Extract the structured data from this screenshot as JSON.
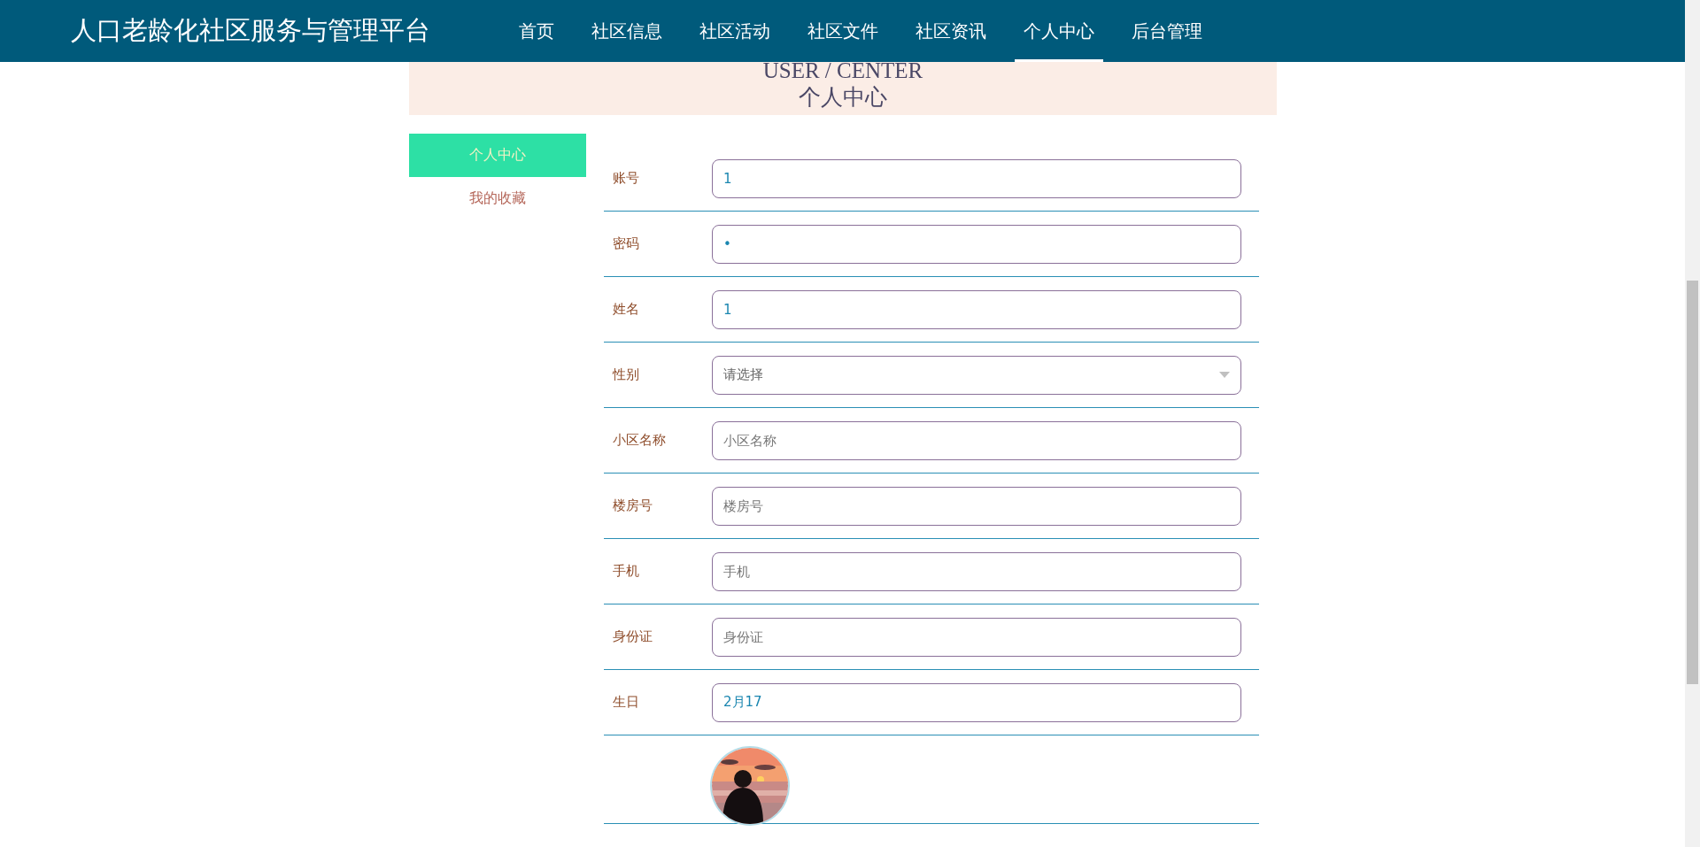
{
  "header": {
    "title": "人口老龄化社区服务与管理平台",
    "nav": [
      {
        "label": "首页",
        "selected": false
      },
      {
        "label": "社区信息",
        "selected": false
      },
      {
        "label": "社区活动",
        "selected": false
      },
      {
        "label": "社区文件",
        "selected": false
      },
      {
        "label": "社区资讯",
        "selected": false
      },
      {
        "label": "个人中心",
        "selected": true
      },
      {
        "label": "后台管理",
        "selected": false
      }
    ]
  },
  "banner": {
    "subtitle": "USER / CENTER",
    "title": "个人中心"
  },
  "sidebar": {
    "items": [
      {
        "label": "个人中心",
        "selected": true
      },
      {
        "label": "我的收藏",
        "selected": false
      }
    ]
  },
  "form": {
    "fields": [
      {
        "kind": "input",
        "label": "账号",
        "value": "1"
      },
      {
        "kind": "input",
        "label": "密码",
        "value": "•"
      },
      {
        "kind": "input",
        "label": "姓名",
        "value": "1"
      },
      {
        "kind": "select",
        "label": "性别",
        "placeholder": "请选择"
      },
      {
        "kind": "input",
        "label": "小区名称",
        "placeholder": "小区名称"
      },
      {
        "kind": "input",
        "label": "楼房号",
        "placeholder": "楼房号"
      },
      {
        "kind": "input",
        "label": "手机",
        "placeholder": "手机"
      },
      {
        "kind": "input",
        "label": "身份证",
        "placeholder": "身份证"
      },
      {
        "kind": "input",
        "label": "生日",
        "value": "2月17"
      },
      {
        "kind": "picture"
      }
    ]
  }
}
